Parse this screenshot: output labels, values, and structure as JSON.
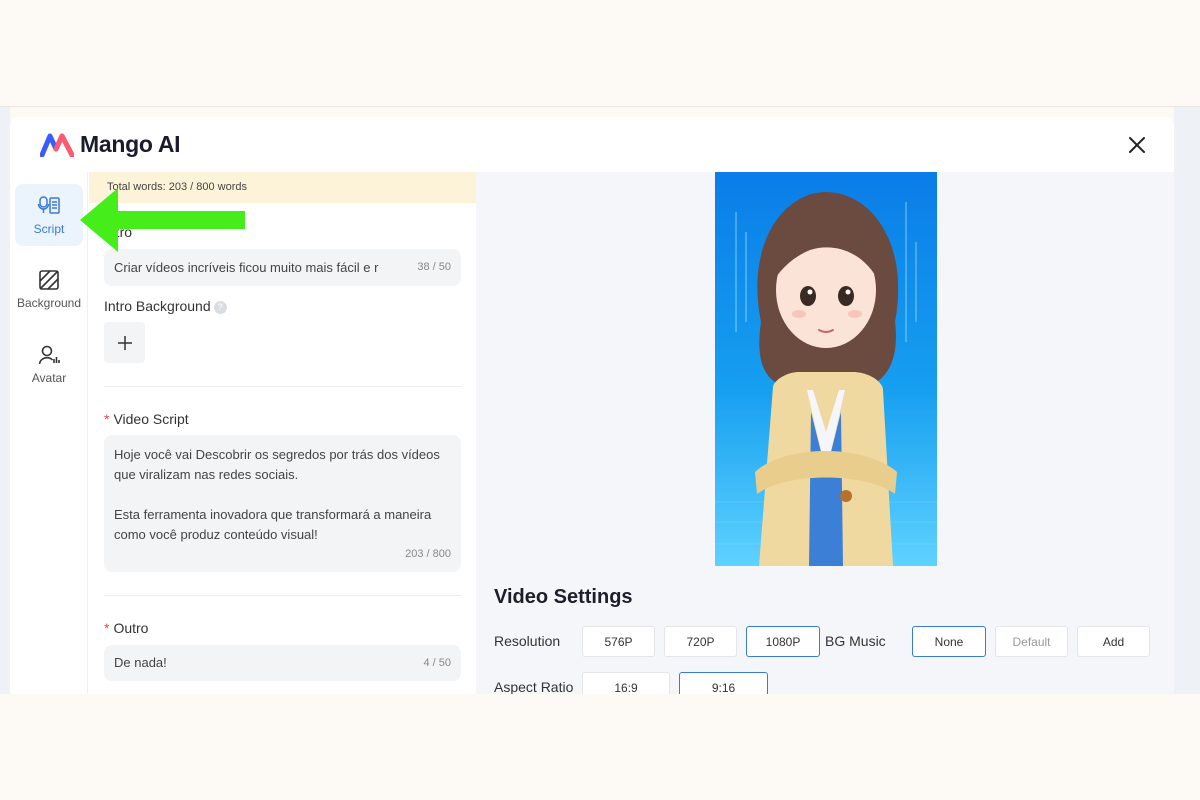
{
  "app": {
    "name": "Mango AI"
  },
  "colors": {
    "accent": "#3a7bd5",
    "arrow": "#45ee1b",
    "banner": "#fcf3d8"
  },
  "sidebar": {
    "items": [
      {
        "label": "Script",
        "icon": "microphone-script-icon",
        "active": true
      },
      {
        "label": "Background",
        "icon": "background-icon",
        "active": false
      },
      {
        "label": "Avatar",
        "icon": "avatar-icon",
        "active": false
      }
    ]
  },
  "editor": {
    "words_banner": "Total words: 203 / 800 words",
    "intro": {
      "label": "Intro",
      "value": "Criar vídeos incríveis ficou muito mais fácil e r",
      "count": "38 / 50"
    },
    "intro_background": {
      "label": "Intro Background",
      "add_icon": "plus-icon"
    },
    "video_script": {
      "label": "Video Script",
      "paragraph1": "Hoje você vai Descobrir os segredos por trás dos vídeos que viralizam nas redes sociais.",
      "paragraph2": "Esta ferramenta inovadora que transformará a maneira como você produz conteúdo visual!",
      "count": "203 / 800"
    },
    "outro": {
      "label": "Outro",
      "value": "De nada!",
      "count": "4 / 50"
    }
  },
  "settings": {
    "title": "Video Settings",
    "resolution": {
      "label": "Resolution",
      "options": [
        "576P",
        "720P",
        "1080P"
      ],
      "selected": "1080P"
    },
    "bg_music": {
      "label": "BG Music",
      "options": [
        "None",
        "Default",
        "Add"
      ],
      "selected": "None"
    },
    "aspect_ratio": {
      "label": "Aspect Ratio",
      "options": [
        "16:9",
        "9:16"
      ],
      "selected": "9:16"
    }
  }
}
